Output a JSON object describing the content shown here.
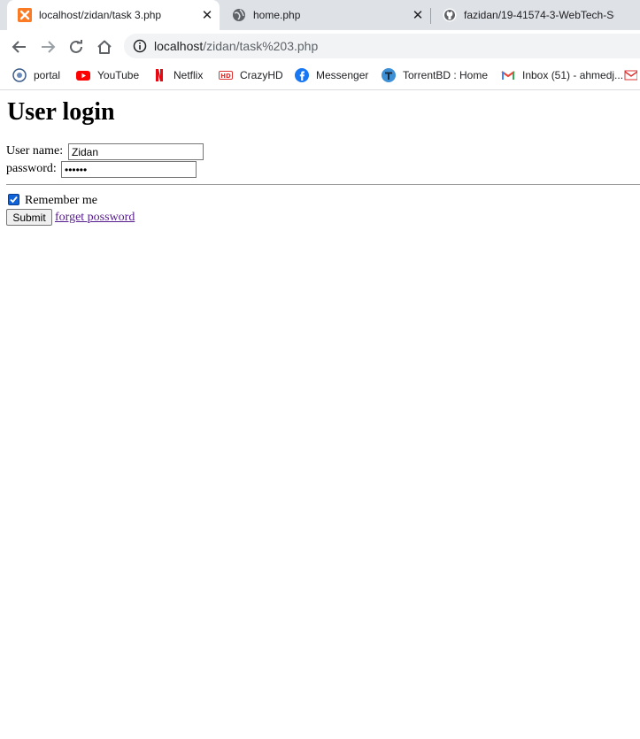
{
  "browser": {
    "tabs": [
      {
        "title": "localhost/zidan/task 3.php",
        "icon": "xampp-icon",
        "active": true
      },
      {
        "title": "home.php",
        "icon": "globe-icon",
        "active": false
      },
      {
        "title": "fazidan/19-41574-3-WebTech-Se",
        "icon": "github-icon",
        "active": false
      }
    ],
    "address": {
      "host": "localhost",
      "path": "/zidan/task%203.php"
    },
    "bookmarks": [
      {
        "label": "portal",
        "icon": "portal-icon"
      },
      {
        "label": "YouTube",
        "icon": "youtube-icon"
      },
      {
        "label": "Netflix",
        "icon": "netflix-icon"
      },
      {
        "label": "CrazyHD",
        "icon": "crazyhd-icon"
      },
      {
        "label": "Messenger",
        "icon": "messenger-icon"
      },
      {
        "label": "TorrentBD : Home",
        "icon": "torrentbd-icon"
      },
      {
        "label": "Inbox (51) - ahmedj...",
        "icon": "gmail-icon"
      }
    ]
  },
  "page": {
    "heading": "User login",
    "username_label": "User name:",
    "username_value": "Zidan",
    "password_label": "password:",
    "password_value": "••••••",
    "remember_label": "Remember me",
    "remember_checked": true,
    "submit_label": "Submit",
    "forget_link": "forget possword"
  },
  "colors": {
    "accent_checkbox": "#0f62d8",
    "visited_link": "#551a8b"
  }
}
